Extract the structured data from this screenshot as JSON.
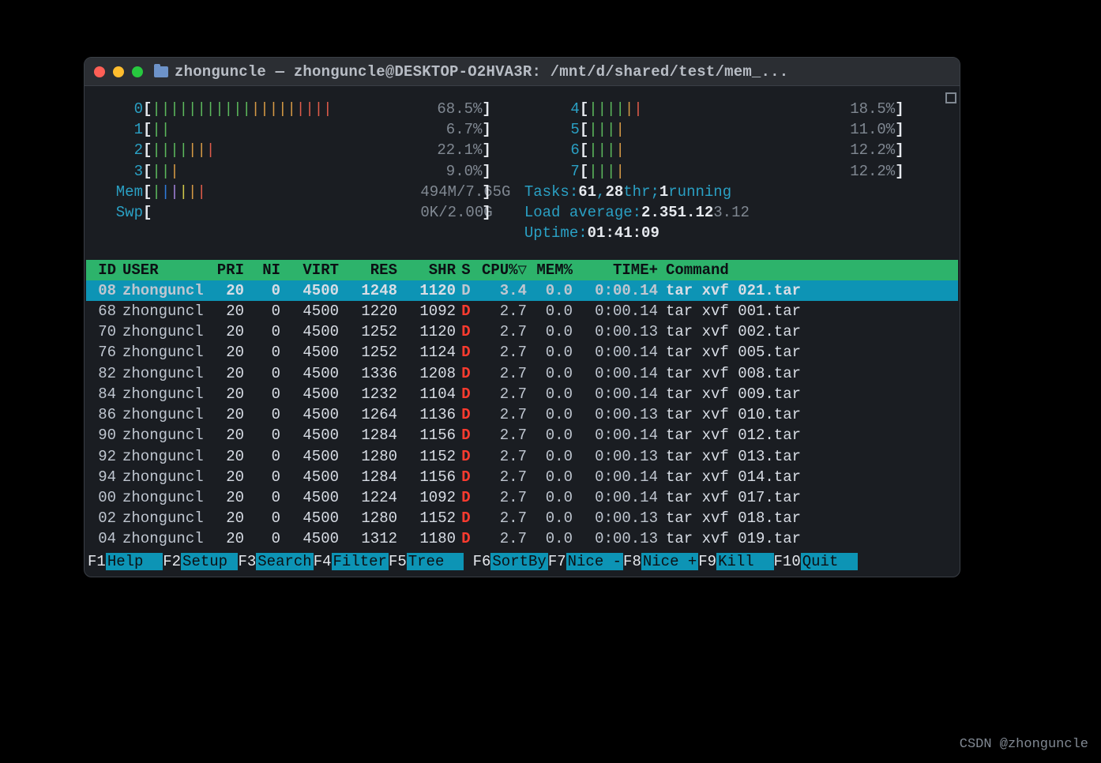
{
  "window": {
    "title": "zhonguncle — zhonguncle@DESKTOP-O2HVA3R: /mnt/d/shared/test/mem_..."
  },
  "cpu_left": [
    {
      "label": "0",
      "pct": "68.5%",
      "bars": "||||||||||||||||||||"
    },
    {
      "label": "1",
      "pct": "6.7%",
      "bars": "||"
    },
    {
      "label": "2",
      "pct": "22.1%",
      "bars": "|||||||"
    },
    {
      "label": "3",
      "pct": "9.0%",
      "bars": "|||"
    }
  ],
  "cpu_right": [
    {
      "label": "4",
      "pct": "18.5%",
      "bars": "||||||"
    },
    {
      "label": "5",
      "pct": "11.0%",
      "bars": "||||"
    },
    {
      "label": "6",
      "pct": "12.2%",
      "bars": "||||"
    },
    {
      "label": "7",
      "pct": "12.2%",
      "bars": "||||"
    }
  ],
  "mem": {
    "label": "Mem",
    "value": "494M/7.65G",
    "bars": "||||||"
  },
  "swp": {
    "label": "Swp",
    "value": "0K/2.00G",
    "bars": ""
  },
  "tasks": {
    "label": "Tasks:",
    "total": "61",
    "thr": "28",
    "thr_label": "thr;",
    "running": "1",
    "running_label": "running"
  },
  "load": {
    "label": "Load average:",
    "v1": "2.35",
    "v2": "1.12",
    "v3": "3.12"
  },
  "uptime": {
    "label": "Uptime:",
    "value": "01:41:09"
  },
  "columns": {
    "id": "ID",
    "user": "USER",
    "pri": "PRI",
    "ni": "NI",
    "virt": "VIRT",
    "res": "RES",
    "shr": "SHR",
    "s": "S",
    "cpu": "CPU%▽",
    "mem": "MEM%",
    "time": "TIME+",
    "cmd": "Command"
  },
  "processes": [
    {
      "id": "08",
      "user": "zhonguncl",
      "pri": "20",
      "ni": "0",
      "virt": "4500",
      "res": "1248",
      "shr": "1120",
      "s": "D",
      "cpu": "3.4",
      "mem": "0.0",
      "time": "0:00.14",
      "cmd": "tar xvf 021.tar",
      "selected": true
    },
    {
      "id": "68",
      "user": "zhonguncl",
      "pri": "20",
      "ni": "0",
      "virt": "4500",
      "res": "1220",
      "shr": "1092",
      "s": "D",
      "cpu": "2.7",
      "mem": "0.0",
      "time": "0:00.14",
      "cmd": "tar xvf 001.tar"
    },
    {
      "id": "70",
      "user": "zhonguncl",
      "pri": "20",
      "ni": "0",
      "virt": "4500",
      "res": "1252",
      "shr": "1120",
      "s": "D",
      "cpu": "2.7",
      "mem": "0.0",
      "time": "0:00.13",
      "cmd": "tar xvf 002.tar"
    },
    {
      "id": "76",
      "user": "zhonguncl",
      "pri": "20",
      "ni": "0",
      "virt": "4500",
      "res": "1252",
      "shr": "1124",
      "s": "D",
      "cpu": "2.7",
      "mem": "0.0",
      "time": "0:00.14",
      "cmd": "tar xvf 005.tar"
    },
    {
      "id": "82",
      "user": "zhonguncl",
      "pri": "20",
      "ni": "0",
      "virt": "4500",
      "res": "1336",
      "shr": "1208",
      "s": "D",
      "cpu": "2.7",
      "mem": "0.0",
      "time": "0:00.14",
      "cmd": "tar xvf 008.tar"
    },
    {
      "id": "84",
      "user": "zhonguncl",
      "pri": "20",
      "ni": "0",
      "virt": "4500",
      "res": "1232",
      "shr": "1104",
      "s": "D",
      "cpu": "2.7",
      "mem": "0.0",
      "time": "0:00.14",
      "cmd": "tar xvf 009.tar"
    },
    {
      "id": "86",
      "user": "zhonguncl",
      "pri": "20",
      "ni": "0",
      "virt": "4500",
      "res": "1264",
      "shr": "1136",
      "s": "D",
      "cpu": "2.7",
      "mem": "0.0",
      "time": "0:00.13",
      "cmd": "tar xvf 010.tar"
    },
    {
      "id": "90",
      "user": "zhonguncl",
      "pri": "20",
      "ni": "0",
      "virt": "4500",
      "res": "1284",
      "shr": "1156",
      "s": "D",
      "cpu": "2.7",
      "mem": "0.0",
      "time": "0:00.14",
      "cmd": "tar xvf 012.tar"
    },
    {
      "id": "92",
      "user": "zhonguncl",
      "pri": "20",
      "ni": "0",
      "virt": "4500",
      "res": "1280",
      "shr": "1152",
      "s": "D",
      "cpu": "2.7",
      "mem": "0.0",
      "time": "0:00.13",
      "cmd": "tar xvf 013.tar"
    },
    {
      "id": "94",
      "user": "zhonguncl",
      "pri": "20",
      "ni": "0",
      "virt": "4500",
      "res": "1284",
      "shr": "1156",
      "s": "D",
      "cpu": "2.7",
      "mem": "0.0",
      "time": "0:00.14",
      "cmd": "tar xvf 014.tar"
    },
    {
      "id": "00",
      "user": "zhonguncl",
      "pri": "20",
      "ni": "0",
      "virt": "4500",
      "res": "1224",
      "shr": "1092",
      "s": "D",
      "cpu": "2.7",
      "mem": "0.0",
      "time": "0:00.14",
      "cmd": "tar xvf 017.tar"
    },
    {
      "id": "02",
      "user": "zhonguncl",
      "pri": "20",
      "ni": "0",
      "virt": "4500",
      "res": "1280",
      "shr": "1152",
      "s": "D",
      "cpu": "2.7",
      "mem": "0.0",
      "time": "0:00.13",
      "cmd": "tar xvf 018.tar"
    },
    {
      "id": "04",
      "user": "zhonguncl",
      "pri": "20",
      "ni": "0",
      "virt": "4500",
      "res": "1312",
      "shr": "1180",
      "s": "D",
      "cpu": "2.7",
      "mem": "0.0",
      "time": "0:00.13",
      "cmd": "tar xvf 019.tar"
    }
  ],
  "fkeys": [
    {
      "num": "F1",
      "label": "Help  "
    },
    {
      "num": "F2",
      "label": "Setup "
    },
    {
      "num": "F3",
      "label": "Search"
    },
    {
      "num": "F4",
      "label": "Filter"
    },
    {
      "num": "F5",
      "label": "Tree  "
    },
    {
      "num": "F6",
      "label": "SortBy"
    },
    {
      "num": "F7",
      "label": "Nice -"
    },
    {
      "num": "F8",
      "label": "Nice +"
    },
    {
      "num": "F9",
      "label": "Kill  "
    },
    {
      "num": "F10",
      "label": "Quit  "
    }
  ],
  "watermark": "CSDN @zhonguncle"
}
